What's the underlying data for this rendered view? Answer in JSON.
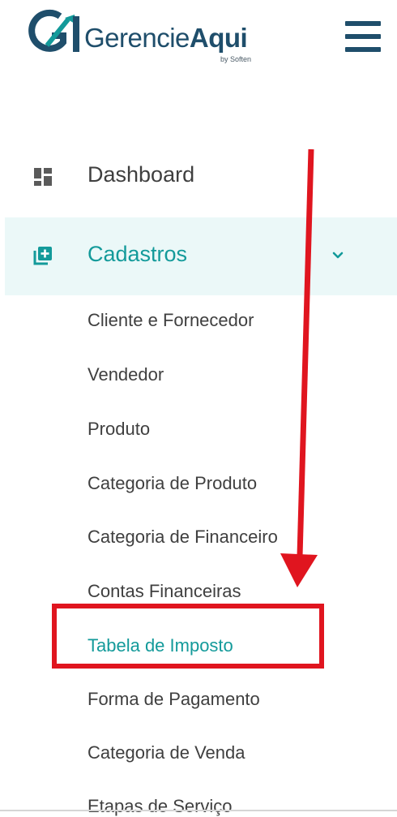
{
  "brand": {
    "name_regular": "Gerencie",
    "name_bold": "Aqui",
    "byline": "by Soften",
    "primary_color": "#1f4e6b",
    "accent_color": "#139a9a"
  },
  "header": {
    "menu_icon": "hamburger-icon"
  },
  "sidebar": {
    "items": [
      {
        "label": "Dashboard",
        "icon": "dashboard-icon",
        "active": false
      },
      {
        "label": "Cadastros",
        "icon": "add-box-icon",
        "active": true,
        "expand_icon": "chevron-down-icon"
      }
    ],
    "cadastros_submenu": [
      {
        "label": "Cliente e Fornecedor"
      },
      {
        "label": "Vendedor"
      },
      {
        "label": "Produto"
      },
      {
        "label": "Categoria de Produto"
      },
      {
        "label": "Categoria de Financeiro"
      },
      {
        "label": "Contas Financeiras"
      },
      {
        "label": "Tabela de Imposto",
        "active": true
      },
      {
        "label": "Forma de Pagamento"
      },
      {
        "label": "Categoria de Venda"
      },
      {
        "label": "Etapas de Serviço"
      }
    ]
  },
  "annotation": {
    "color": "#e0151f",
    "highlight_target": "Tabela de Imposto"
  }
}
